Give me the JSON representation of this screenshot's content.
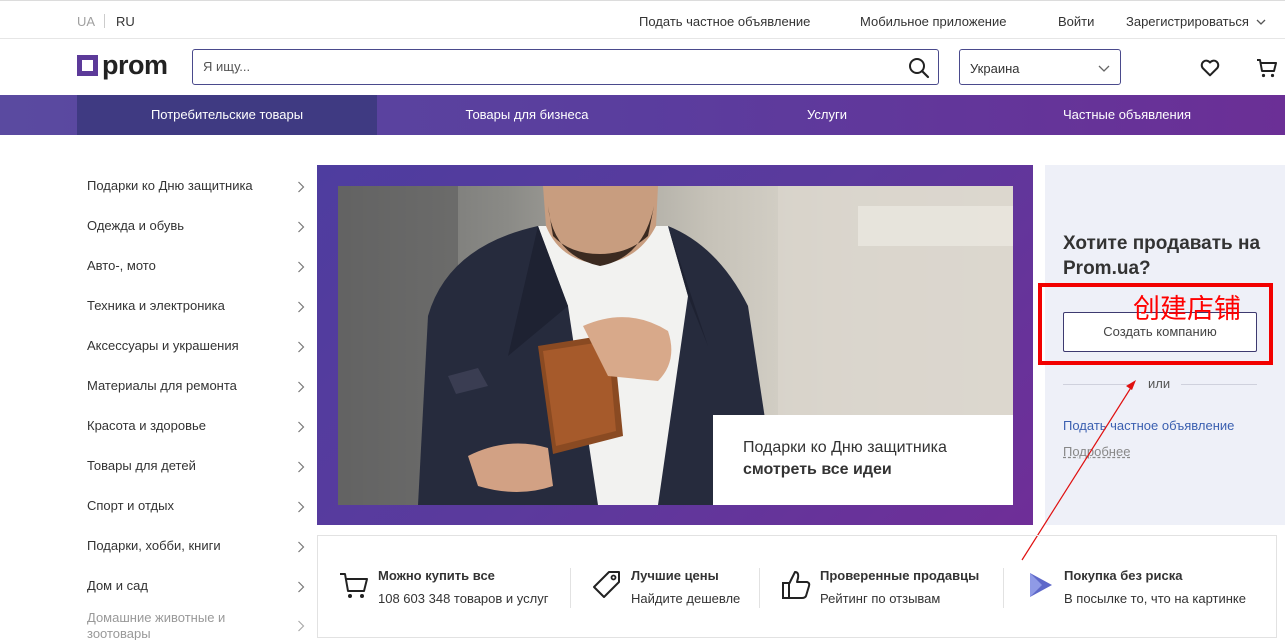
{
  "topbar": {
    "lang_ua": "UA",
    "lang_ru": "RU",
    "links": [
      "Подать частное объявление",
      "Мобильное приложение",
      "Войти",
      "Зарегистрироваться"
    ]
  },
  "header": {
    "logo_text": "prom",
    "search_placeholder": "Я ищу...",
    "region": "Украина"
  },
  "nav": {
    "items": [
      "Потребительские товары",
      "Товары для бизнеса",
      "Услуги",
      "Частные объявления"
    ],
    "active_index": 0
  },
  "sidebar": {
    "categories": [
      "Подарки ко Дню защитника",
      "Одежда и обувь",
      "Авто-, мото",
      "Техника и электроника",
      "Аксессуары и украшения",
      "Материалы для ремонта",
      "Красота и здоровье",
      "Товары для детей",
      "Спорт и отдых",
      "Подарки, хобби, книги",
      "Дом и сад",
      "Домашние животные и зоотовары"
    ]
  },
  "banner": {
    "caption_line1": "Подарки ко Дню защитника",
    "caption_line2": "смотреть все идеи"
  },
  "sell_panel": {
    "title": "Хотите продавать на Prom.ua?",
    "create_button": "Создать компанию",
    "or_text": "или",
    "private_ad_link": "Подать частное объявление",
    "more_link": "Подробнее"
  },
  "annotation": {
    "text": "创建店铺",
    "color": "#ff0000"
  },
  "features": [
    {
      "icon": "cart-icon",
      "title": "Можно купить все",
      "subtitle": "108 603 348 товаров и услуг"
    },
    {
      "icon": "price-tag-icon",
      "title": "Лучшие цены",
      "subtitle": "Найдите дешевле"
    },
    {
      "icon": "thumbs-up-icon",
      "title": "Проверенные продавцы",
      "subtitle": "Рейтинг по отзывам"
    },
    {
      "icon": "play-shield-icon",
      "title": "Покупка без риска",
      "subtitle": "В посылке то, что на картинке"
    }
  ],
  "colors": {
    "brand_purple": "#5c3a99",
    "nav_active": "#3f3a82",
    "link_blue": "#3a5fb0",
    "panel_bg": "#eef0f8"
  }
}
